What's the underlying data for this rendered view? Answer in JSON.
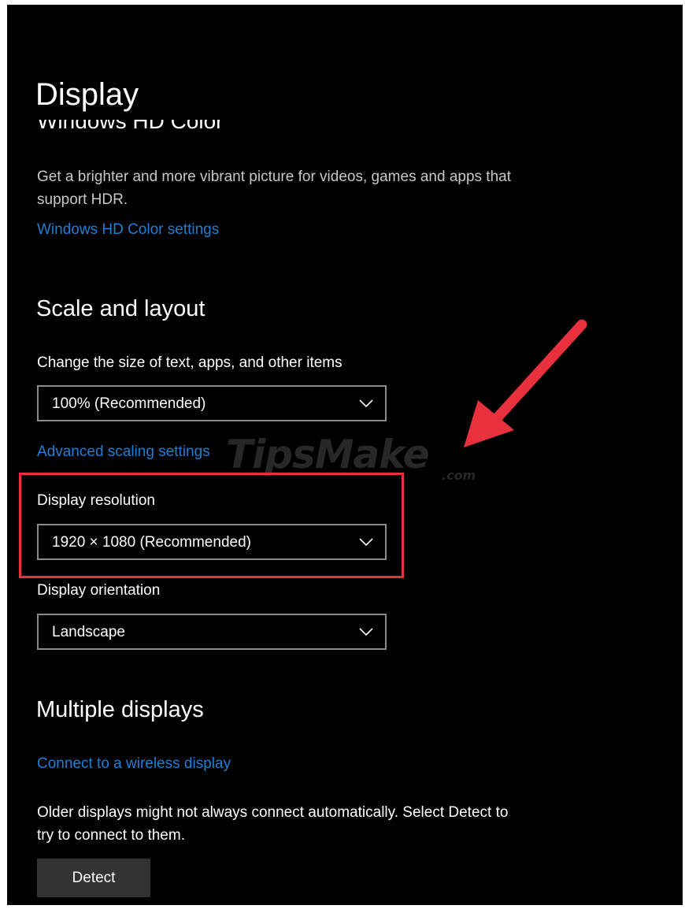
{
  "header": {
    "title": "Display",
    "scrolled_section_title": "Windows HD Color"
  },
  "hdr": {
    "description_line1": "Get a brighter and more vibrant picture for videos, games and apps that",
    "description_line2": "support HDR.",
    "settings_link": "Windows HD Color settings"
  },
  "scale_layout": {
    "title": "Scale and layout",
    "size_label": "Change the size of text, apps, and other items",
    "size_value": "100% (Recommended)",
    "advanced_link": "Advanced scaling settings",
    "resolution_label": "Display resolution",
    "resolution_value": "1920 × 1080 (Recommended)",
    "orientation_label": "Display orientation",
    "orientation_value": "Landscape"
  },
  "multiple_displays": {
    "title": "Multiple displays",
    "wireless_link": "Connect to a wireless display",
    "note_line1": "Older displays might not always connect automatically. Select Detect to",
    "note_line2": "try to connect to them.",
    "detect_label": "Detect"
  },
  "annotation": {
    "highlight_color": "#e8313d",
    "arrow_color": "#e8313d",
    "watermark": "TipsMake",
    "watermark_suffix": ".com"
  },
  "colors": {
    "background": "#000000",
    "link": "#1e7fd6",
    "text": "#ffffff",
    "secondary_text": "#c8c8c8",
    "button": "#333333"
  },
  "icons": {
    "dropdown": "chevron-down-icon",
    "arrow": "red-arrow-icon"
  }
}
